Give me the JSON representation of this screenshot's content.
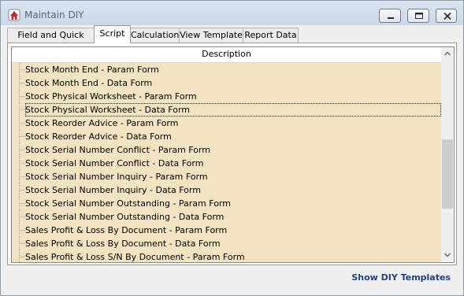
{
  "window": {
    "title": "Maintain DIY"
  },
  "tabs": [
    {
      "label": "Field and Quick Form"
    },
    {
      "label": "Script"
    },
    {
      "label": "Calculation"
    },
    {
      "label": "View Template"
    },
    {
      "label": "Report Data"
    }
  ],
  "active_tab": "Script",
  "grid": {
    "column_header": "Description",
    "rows": [
      "Stock Month End - Param Form",
      "Stock Month End - Data Form",
      "Stock Physical Worksheet - Param Form",
      "Stock Physical Worksheet - Data Form",
      "Stock Reorder Advice - Param Form",
      "Stock Reorder Advice - Data Form",
      "Stock Serial Number Conflict - Param Form",
      "Stock Serial Number Conflict - Data Form",
      "Stock Serial Number Inquiry - Param Form",
      "Stock Serial Number Inquiry - Data Form",
      "Stock Serial Number Outstanding - Param Form",
      "Stock Serial Number Outstanding - Data Form",
      "Sales Profit & Loss By Document - Param Form",
      "Sales Profit & Loss By Document - Data Form",
      "Sales Profit & Loss S/N By Document - Param Form"
    ],
    "selected_row": "Stock Physical Worksheet - Data Form",
    "row_color": "#f2e3c1"
  },
  "footer": {
    "show_templates_label": "Show DIY Templates"
  },
  "icons": {
    "app": "app-icon",
    "minimize": "minimize-icon",
    "maximize": "maximize-icon",
    "close": "close-icon",
    "scroll_up": "chevron-up-icon",
    "scroll_down": "chevron-down-icon"
  }
}
